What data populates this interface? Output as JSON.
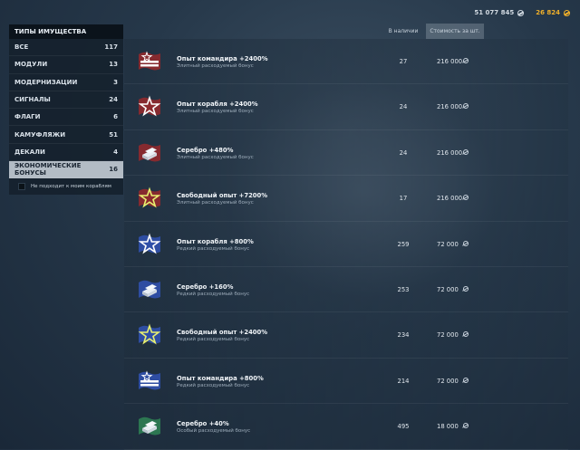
{
  "currency": {
    "credits": "51 077 845",
    "gold": "26 824",
    "credits_icon": "credits-icon",
    "gold_icon": "doubloons-icon"
  },
  "sidebar": {
    "title": "ТИПЫ ИМУЩЕСТВА",
    "items": [
      {
        "label": "ВСЕ",
        "count": "117"
      },
      {
        "label": "МОДУЛИ",
        "count": "13"
      },
      {
        "label": "МОДЕРНИЗАЦИИ",
        "count": "3"
      },
      {
        "label": "СИГНАЛЫ",
        "count": "24"
      },
      {
        "label": "ФЛАГИ",
        "count": "6"
      },
      {
        "label": "КАМУФЛЯЖИ",
        "count": "51"
      },
      {
        "label": "ДЕКАЛИ",
        "count": "4"
      },
      {
        "label": "ЭКОНОМИЧЕСКИЕ БОНУСЫ",
        "count": "16"
      }
    ],
    "active_index": 7,
    "filter_label": "Не подходит к моим кораблям"
  },
  "table": {
    "col_stock": "В наличии",
    "col_price": "Стоимость за шт.",
    "rows": [
      {
        "name": "Опыт командира +2400%",
        "sub": "Элитный расходуемый бонус",
        "stock": "27",
        "price": "216 000",
        "icon": "commander-xp-icon",
        "tier": "elite"
      },
      {
        "name": "Опыт корабля +2400%",
        "sub": "Элитный расходуемый бонус",
        "stock": "24",
        "price": "216 000",
        "icon": "ship-xp-icon",
        "tier": "elite"
      },
      {
        "name": "Серебро +480%",
        "sub": "Элитный расходуемый бонус",
        "stock": "24",
        "price": "216 000",
        "icon": "credits-bonus-icon",
        "tier": "elite"
      },
      {
        "name": "Свободный опыт +7200%",
        "sub": "Элитный расходуемый бонус",
        "stock": "17",
        "price": "216 000",
        "icon": "free-xp-icon",
        "tier": "elite"
      },
      {
        "name": "Опыт корабля +800%",
        "sub": "Редкий расходуемый бонус",
        "stock": "259",
        "price": "72 000",
        "icon": "ship-xp-icon",
        "tier": "rare"
      },
      {
        "name": "Серебро +160%",
        "sub": "Редкий расходуемый бонус",
        "stock": "253",
        "price": "72 000",
        "icon": "credits-bonus-icon",
        "tier": "rare"
      },
      {
        "name": "Свободный опыт +2400%",
        "sub": "Редкий расходуемый бонус",
        "stock": "234",
        "price": "72 000",
        "icon": "free-xp-icon",
        "tier": "rare"
      },
      {
        "name": "Опыт командира +800%",
        "sub": "Редкий расходуемый бонус",
        "stock": "214",
        "price": "72 000",
        "icon": "commander-xp-icon",
        "tier": "rare"
      },
      {
        "name": "Серебро +40%",
        "sub": "Особый расходуемый бонус",
        "stock": "495",
        "price": "18 000",
        "icon": "credits-bonus-icon",
        "tier": "special"
      }
    ]
  },
  "colors": {
    "elite": "#8c2a2e",
    "rare": "#2f4fa8",
    "special": "#2d7a52",
    "gold": "#f0b02a"
  }
}
